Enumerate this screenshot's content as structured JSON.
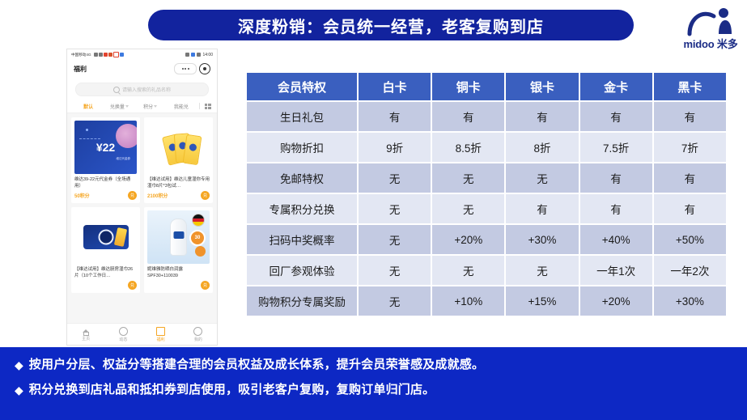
{
  "slide": {
    "title": "深度粉销：会员统一经营，老客复购到店",
    "brand": "midoo 米多",
    "accent_blue": "#12239E",
    "table_header_blue": "#3A5FBF",
    "band_blue": "#0D28C4"
  },
  "phone": {
    "status": {
      "carrier": "中国移动4G",
      "time": "14:00"
    },
    "header_title": "福利",
    "search_placeholder": "请输入搜索的礼品名称",
    "filters": [
      {
        "label": "默认",
        "active": true,
        "caret": false
      },
      {
        "label": "兑换量",
        "active": false,
        "caret": true
      },
      {
        "label": "积分",
        "active": false,
        "caret": true
      },
      {
        "label": "我能兑",
        "active": false,
        "caret": false
      }
    ],
    "cards": [
      {
        "name": "维达39-22元代金券（全场通用）",
        "points": "50积分",
        "action": "兑",
        "amount": "¥22",
        "amount_sub": "维达代金券"
      },
      {
        "name": "【维达试用】维达儿童湿你专用湿巾8片*3包试…",
        "points": "2100积分",
        "action": "兑"
      },
      {
        "name": "【维达试用】维达厨房湿巾26片（10个工作日…",
        "points": "",
        "action": "兑"
      },
      {
        "name": "妮维雅防晒白润露SPF30+110039",
        "points": "",
        "action": "兑",
        "spf": "30"
      }
    ],
    "tabs": [
      {
        "label": "主页",
        "icon": "home-icon",
        "active": false
      },
      {
        "label": "动态",
        "icon": "circle-icon",
        "active": false
      },
      {
        "label": "福利",
        "icon": "gift-icon",
        "active": true
      },
      {
        "label": "我的",
        "icon": "user-icon",
        "active": false
      }
    ]
  },
  "table": {
    "headers": [
      "会员特权",
      "白卡",
      "铜卡",
      "银卡",
      "金卡",
      "黑卡"
    ],
    "rows": [
      {
        "label": "生日礼包",
        "values": [
          "有",
          "有",
          "有",
          "有",
          "有"
        ]
      },
      {
        "label": "购物折扣",
        "values": [
          "9折",
          "8.5折",
          "8折",
          "7.5折",
          "7折"
        ]
      },
      {
        "label": "免邮特权",
        "values": [
          "无",
          "无",
          "无",
          "有",
          "有"
        ]
      },
      {
        "label": "专属积分兑换",
        "values": [
          "无",
          "无",
          "有",
          "有",
          "有"
        ]
      },
      {
        "label": "扫码中奖概率",
        "values": [
          "无",
          "+20%",
          "+30%",
          "+40%",
          "+50%"
        ]
      },
      {
        "label": "回厂参观体验",
        "values": [
          "无",
          "无",
          "无",
          "一年1次",
          "一年2次"
        ]
      },
      {
        "label": "购物积分专属奖励",
        "values": [
          "无",
          "+10%",
          "+15%",
          "+20%",
          "+30%"
        ]
      }
    ]
  },
  "bullets": [
    {
      "marker": "◆",
      "text": "按用户分层、权益分等搭建合理的会员权益及成长体系，提升会员荣誉感及成就感。"
    },
    {
      "marker": "◆",
      "text": "积分兑换到店礼品和抵扣券到店使用，吸引老客户复购，复购订单归门店。"
    }
  ]
}
